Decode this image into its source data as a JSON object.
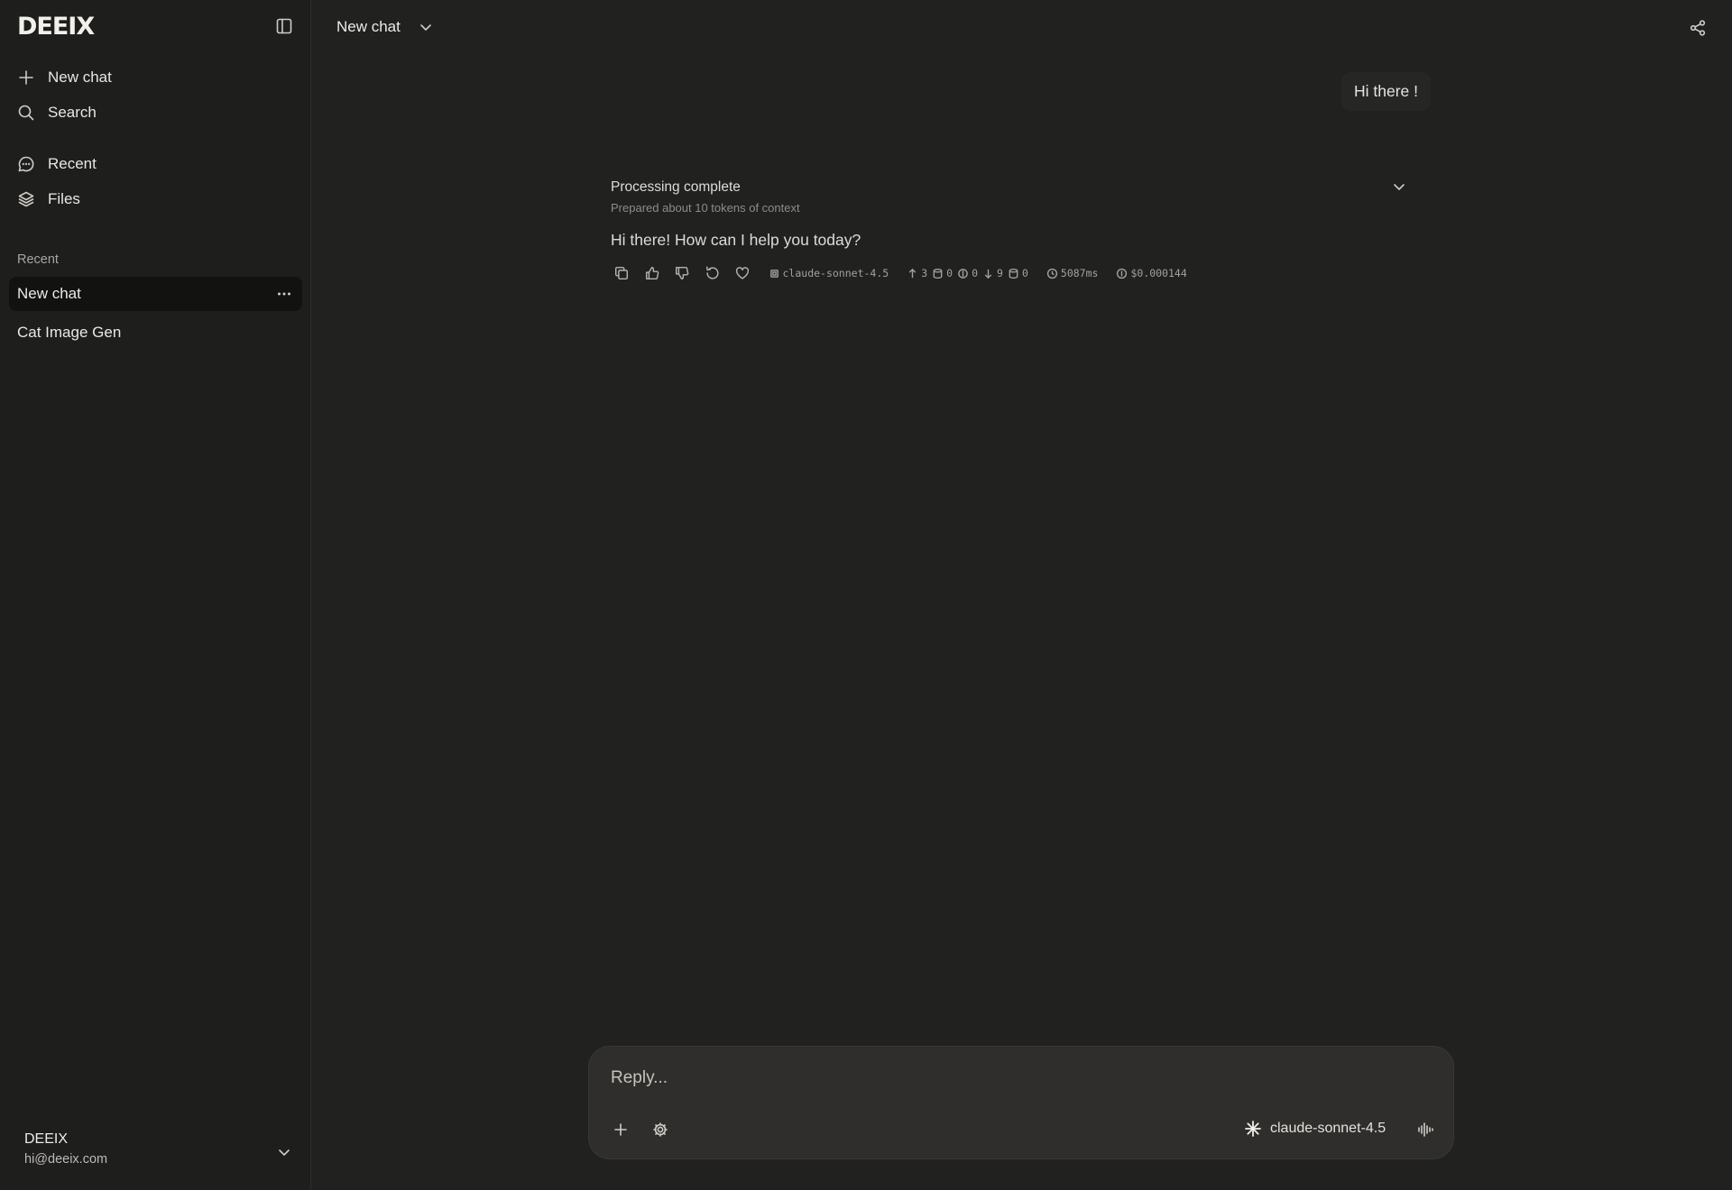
{
  "sidebar": {
    "logo": "DEEIX",
    "nav": [
      {
        "label": "New chat",
        "icon": "plus-icon"
      },
      {
        "label": "Search",
        "icon": "search-icon"
      },
      {
        "label": "Recent",
        "icon": "chat-bubble-icon"
      },
      {
        "label": "Files",
        "icon": "layers-icon"
      }
    ],
    "section_label": "Recent",
    "recent": [
      {
        "label": "New chat",
        "active": true
      },
      {
        "label": "Cat Image Gen",
        "active": false
      }
    ],
    "user": {
      "name": "DEEIX",
      "email": "hi@deeix.com"
    }
  },
  "header": {
    "title": "New chat"
  },
  "conversation": {
    "user_message": "Hi there !",
    "processing": {
      "title": "Processing complete",
      "subtitle": "Prepared about 10 tokens of context"
    },
    "assistant_message": "Hi there! How can I help you today?",
    "meta": {
      "model": "claude-sonnet-4.5",
      "input_tokens": "3",
      "cache_write": "0",
      "reasoning": "0",
      "output_tokens": "9",
      "cache_read": "0",
      "latency": "5087ms",
      "cost": "$0.000144"
    }
  },
  "composer": {
    "placeholder": "Reply...",
    "model": "claude-sonnet-4.5"
  },
  "colors": {
    "background": "#212120",
    "sidebar": "#1e1e1d",
    "active_item": "#121211",
    "composer": "#2f2e2c"
  }
}
